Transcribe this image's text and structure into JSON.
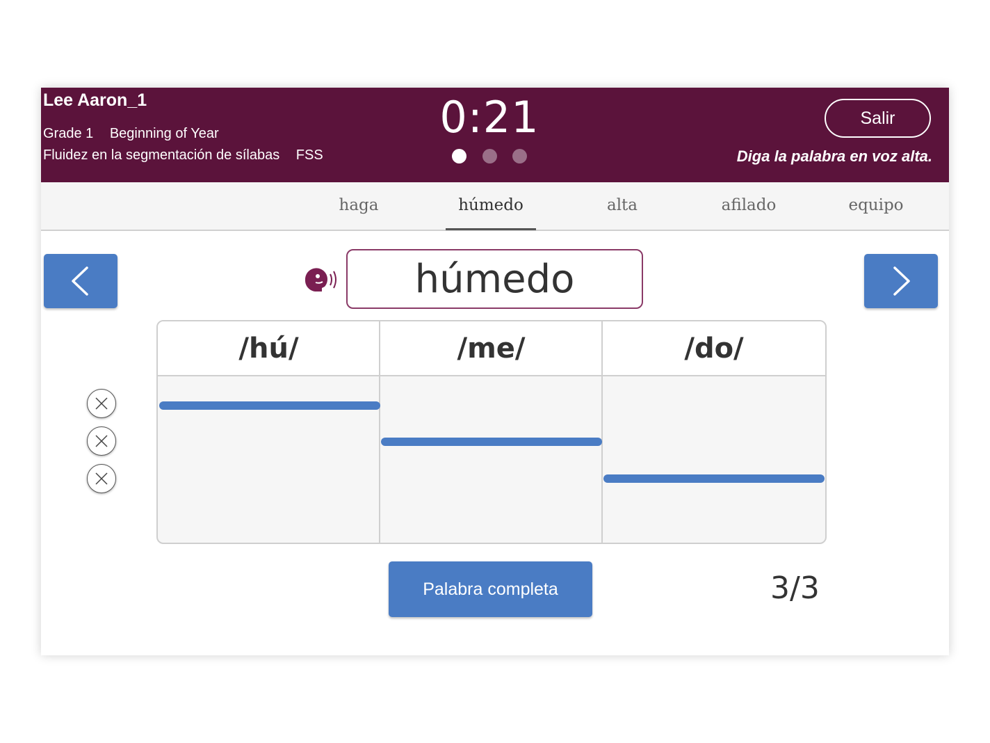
{
  "header": {
    "student_name": "Lee Aaron_1",
    "grade": "Grade 1",
    "period": "Beginning of Year",
    "assessment": "Fluidez en la segmentación de sílabas",
    "assessment_code": "FSS",
    "timer": "0:21",
    "progress_dots": {
      "total": 3,
      "active_index": 0
    },
    "exit_label": "Salir",
    "instruction": "Diga la palabra en voz alta."
  },
  "tabs": [
    {
      "label": "haga",
      "active": false
    },
    {
      "label": "húmedo",
      "active": true
    },
    {
      "label": "alta",
      "active": false
    },
    {
      "label": "afilado",
      "active": false
    },
    {
      "label": "equipo",
      "active": false
    }
  ],
  "word": {
    "text": "húmedo",
    "speaker_icon": "speaking-head-icon"
  },
  "navigation": {
    "prev_icon": "chevron-left-icon",
    "next_icon": "chevron-right-icon"
  },
  "syllables": [
    {
      "label": "/hú/"
    },
    {
      "label": "/me/"
    },
    {
      "label": "/do/"
    }
  ],
  "row_marks": [
    {
      "icon": "close-circle-icon"
    },
    {
      "icon": "close-circle-icon"
    },
    {
      "icon": "close-circle-icon"
    }
  ],
  "footer": {
    "complete_label": "Palabra completa",
    "counter": "3/3"
  },
  "colors": {
    "header_bg": "#5b133b",
    "accent_blue": "#4a7cc4",
    "bubble_border": "#8a3a67"
  }
}
